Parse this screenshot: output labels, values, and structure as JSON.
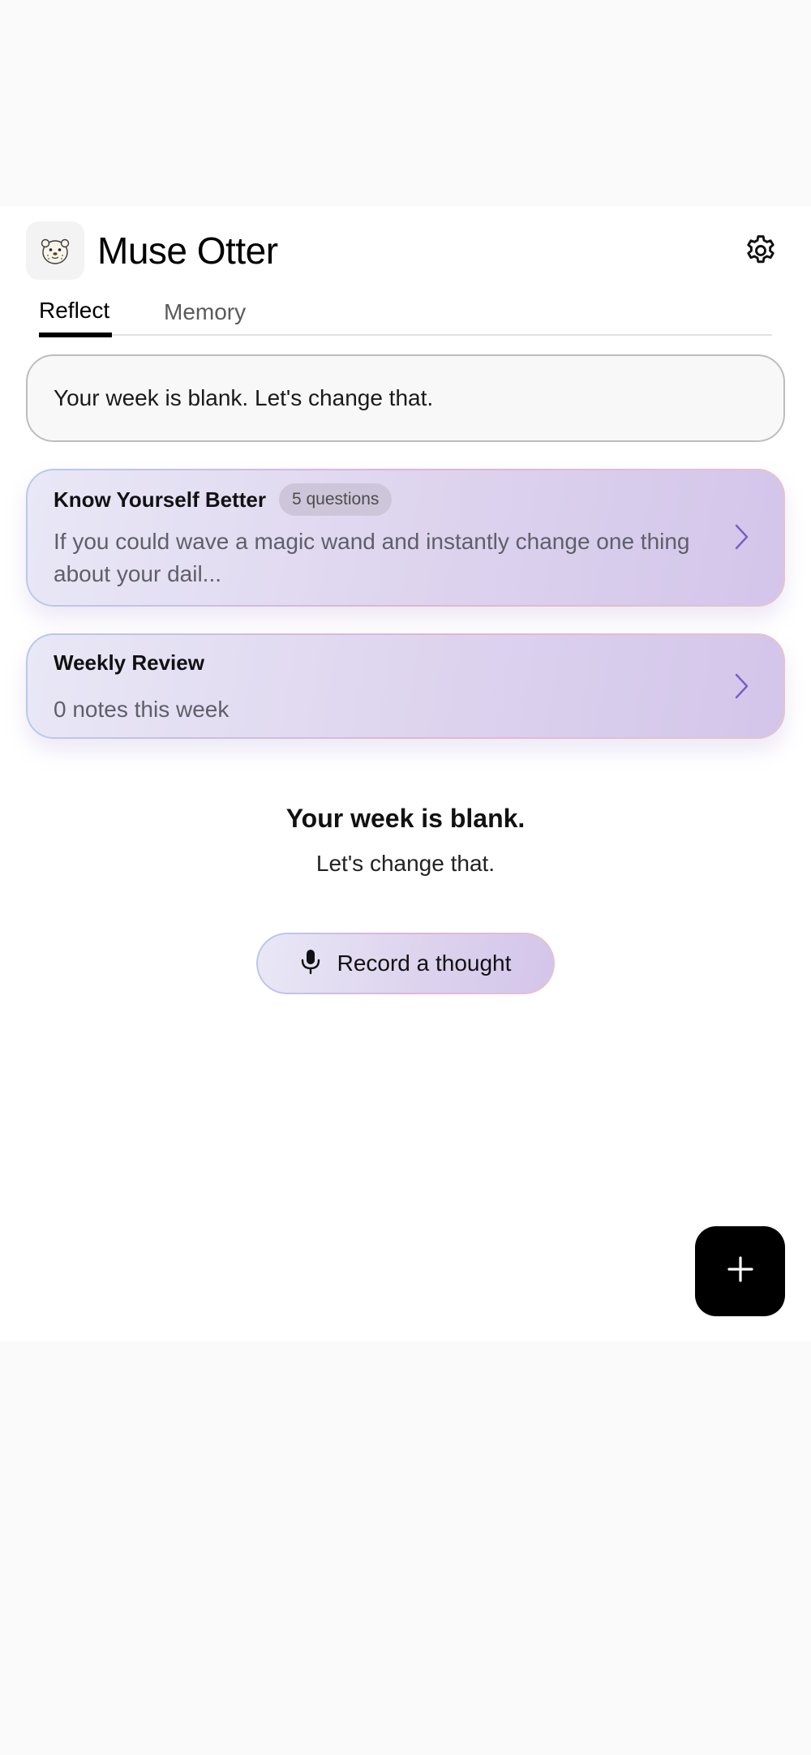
{
  "app": {
    "title": "Muse Otter",
    "logo_icon": "otter-icon",
    "settings_icon": "gear-icon"
  },
  "tabs": [
    {
      "label": "Reflect",
      "active": true
    },
    {
      "label": "Memory",
      "active": false
    }
  ],
  "banner": {
    "text": "Your week is blank. Let's change that."
  },
  "cards": {
    "know_yourself": {
      "title": "Know Yourself Better",
      "badge": "5 questions",
      "subtitle": "If you could wave a magic wand and instantly change one thing about your dail..."
    },
    "weekly_review": {
      "title": "Weekly Review",
      "subtitle": "0 notes this week"
    }
  },
  "empty_state": {
    "title": "Your week is blank.",
    "subtitle": "Let's change that."
  },
  "record_button": {
    "label": "Record a thought",
    "icon": "microphone-icon"
  },
  "fab": {
    "icon": "plus-icon"
  },
  "colors": {
    "accent_purple": "#7b5cc4",
    "card_gradient_start": "#e9e8f6",
    "card_gradient_end": "#d3c5ea",
    "fab_background": "#000000"
  }
}
